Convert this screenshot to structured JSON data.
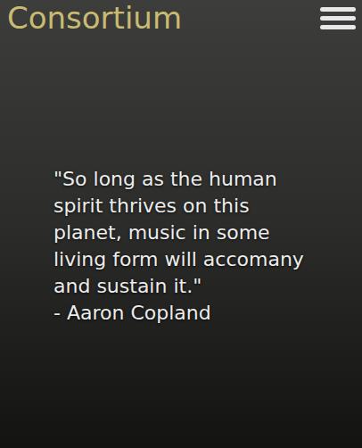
{
  "header": {
    "brand": "Consortium"
  },
  "quote": {
    "text": "\"So long as the human spirit thrives on this planet, music in some living form will accomany and sustain it.\"",
    "author": "- Aaron Copland"
  }
}
